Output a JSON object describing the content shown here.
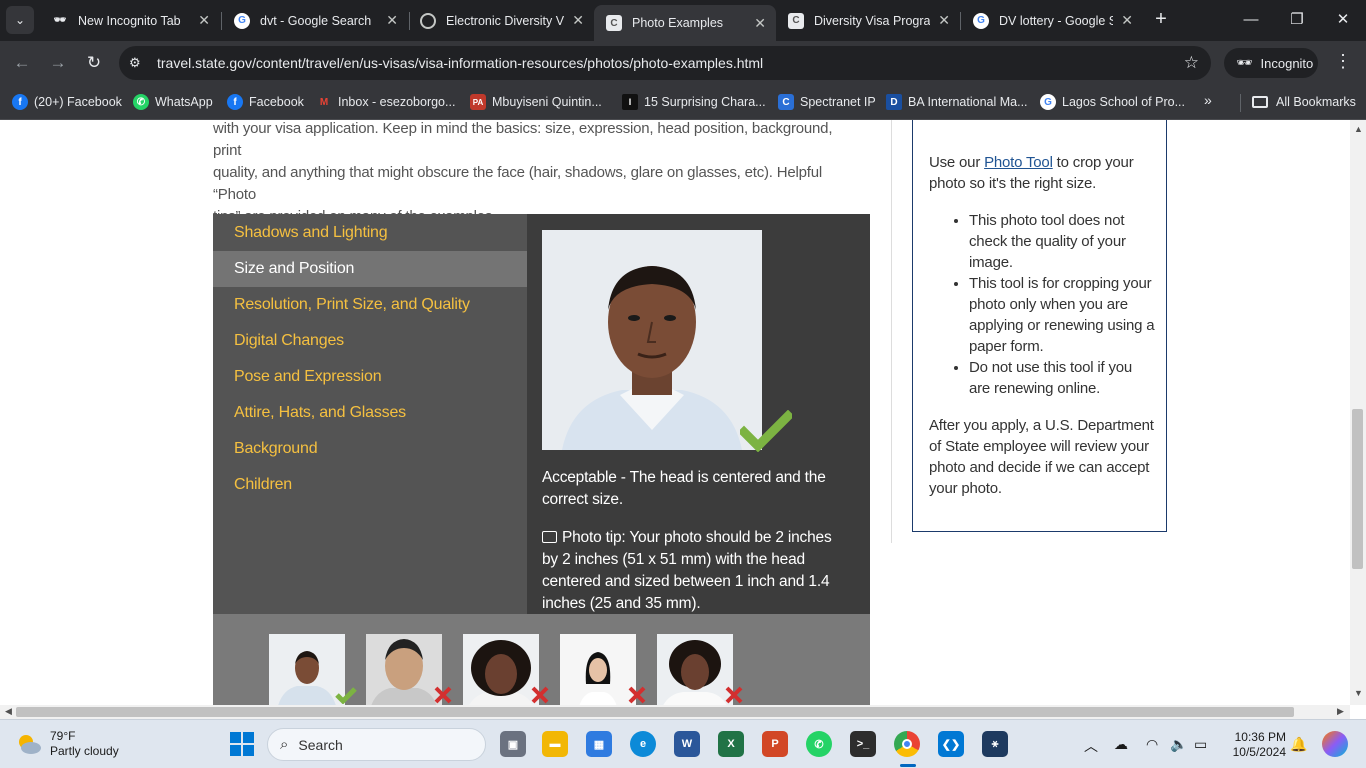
{
  "browser": {
    "tabs": [
      {
        "title": "New Incognito Tab",
        "icon": "incognito-icon",
        "active": false
      },
      {
        "title": "dvt - Google Search",
        "icon": "google-icon",
        "active": false
      },
      {
        "title": "Electronic Diversity Vi",
        "icon": "globe-icon",
        "active": false
      },
      {
        "title": "Photo Examples",
        "icon": "page-icon",
        "active": true
      },
      {
        "title": "Diversity Visa Progra",
        "icon": "page-icon",
        "active": false
      },
      {
        "title": "DV lottery - Google S",
        "icon": "google-icon",
        "active": false
      }
    ],
    "url": "travel.state.gov/content/travel/en/us-visas/visa-information-resources/photos/photo-examples.html",
    "incognito_label": "Incognito",
    "bookmarks": [
      {
        "label": "(20+) Facebook",
        "icon": "facebook-icon"
      },
      {
        "label": "WhatsApp",
        "icon": "whatsapp-icon"
      },
      {
        "label": "Facebook",
        "icon": "facebook-icon"
      },
      {
        "label": "Inbox - esezoborgo...",
        "icon": "gmail-icon"
      },
      {
        "label": "Mbuyiseni Quintin...",
        "icon": "pa-icon"
      },
      {
        "label": "15 Surprising Chara...",
        "icon": "ink-icon"
      },
      {
        "label": "Spectranet IP",
        "icon": "spectranet-icon"
      },
      {
        "label": "BA International Ma...",
        "icon": "d-icon"
      },
      {
        "label": "Lagos School of Pro...",
        "icon": "google-icon"
      }
    ],
    "all_bookmarks_label": "All Bookmarks",
    "more_bookmarks": "»"
  },
  "page": {
    "intro_lines": [
      "with your visa application. Keep in mind the basics: size, expression, head position, background, print",
      "quality, and anything that might obscure the face (hair, shadows, glare on glasses, etc). Helpful “Photo",
      "tips” are provided on many of the examples."
    ],
    "menu": [
      {
        "label": "Shadows and Lighting",
        "selected": false
      },
      {
        "label": "Size and Position",
        "selected": true
      },
      {
        "label": "Resolution, Print Size, and Quality",
        "selected": false
      },
      {
        "label": "Digital Changes",
        "selected": false
      },
      {
        "label": "Pose and Expression",
        "selected": false
      },
      {
        "label": "Attire, Hats, and Glasses",
        "selected": false
      },
      {
        "label": "Background",
        "selected": false
      },
      {
        "label": "Children",
        "selected": false
      }
    ],
    "example": {
      "caption_lines": [
        "Acceptable - The head is centered and the",
        "correct size."
      ],
      "tip_icon": "camera-icon",
      "tip_lines": [
        "Photo tip: Your photo should be 2 inches",
        "by 2 inches (51 x 51 mm) with the head",
        "centered and sized between 1 inch and 1.4",
        "inches (25 and 35 mm)."
      ],
      "status": "acceptable"
    },
    "thumbnails": [
      {
        "status": "acceptable",
        "mark": "check-icon"
      },
      {
        "status": "unacceptable",
        "mark": "x-icon"
      },
      {
        "status": "unacceptable",
        "mark": "x-icon"
      },
      {
        "status": "unacceptable",
        "mark": "x-icon"
      },
      {
        "status": "unacceptable",
        "mark": "x-icon"
      }
    ],
    "sidebar": {
      "p1_prefix": "Use our ",
      "p1_link": "Photo Tool",
      "p1_line1_suffix": " to crop your",
      "p1_line2": "photo so it's the right size.",
      "bullets": [
        [
          "This photo tool does not",
          "check the quality of your",
          "image."
        ],
        [
          "This tool is for cropping your",
          "photo only when you are",
          "applying or renewing using a",
          "paper form."
        ],
        [
          "Do not use this tool if you",
          "are renewing online."
        ]
      ],
      "p2_lines": [
        "After you apply, a U.S. Department",
        "of State employee will review your",
        "photo and decide if we can accept",
        "your photo."
      ]
    }
  },
  "taskbar": {
    "weather_temp": "79°F",
    "weather_desc": "Partly cloudy",
    "search_placeholder": "Search",
    "time": "10:36 PM",
    "date": "10/5/2024"
  },
  "colors": {
    "menu_link": "#f5c040",
    "panel_bg": "#545454",
    "content_bg": "#3c3c3c",
    "acceptable": "#7cb342",
    "unacceptable": "#d32f2f",
    "link": "#205493"
  }
}
